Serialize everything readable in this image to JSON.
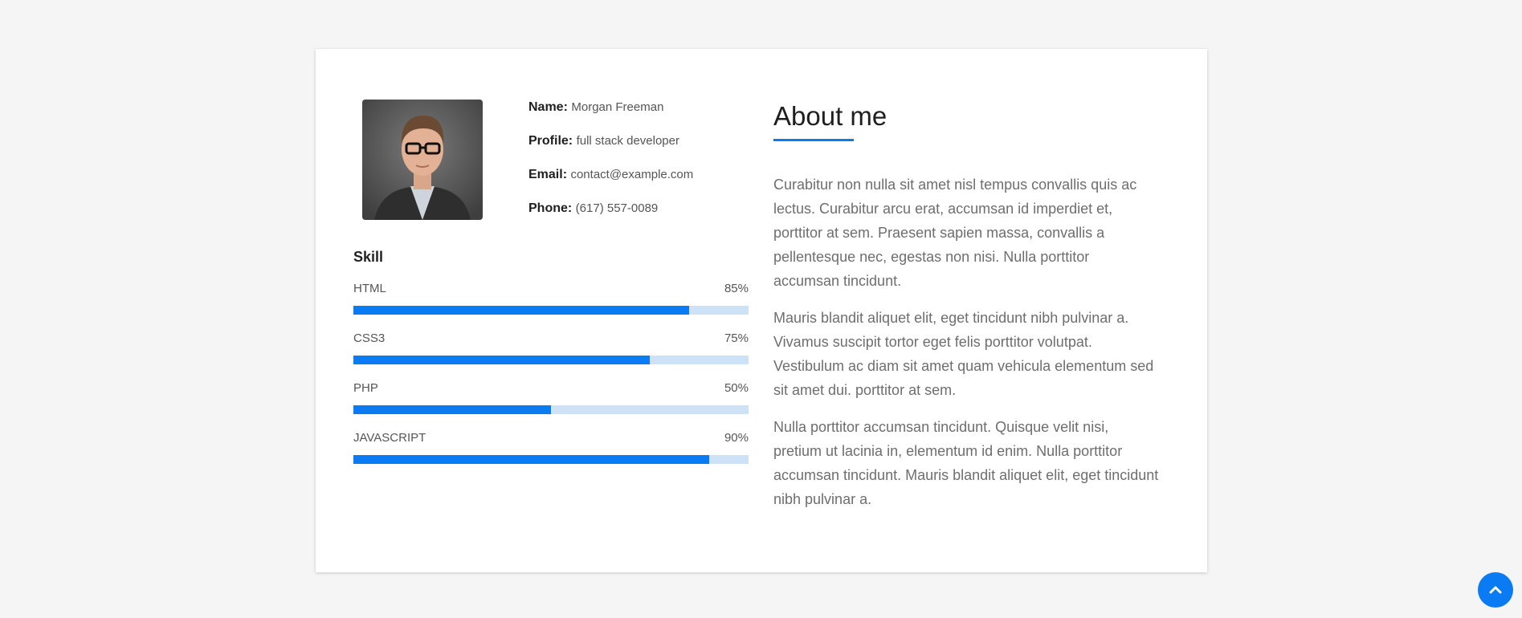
{
  "profile": {
    "name_label": "Name:",
    "name_value": "Morgan Freeman",
    "profile_label": "Profile:",
    "profile_value": "full stack developer",
    "email_label": "Email:",
    "email_value": "contact@example.com",
    "phone_label": "Phone:",
    "phone_value": "(617) 557-0089",
    "photo_icon": "person-photo"
  },
  "skills": {
    "title": "Skill",
    "items": [
      {
        "name": "HTML",
        "percent_label": "85%",
        "value": 85
      },
      {
        "name": "CSS3",
        "percent_label": "75%",
        "value": 75
      },
      {
        "name": "PHP",
        "percent_label": "50%",
        "value": 50
      },
      {
        "name": "JAVASCRIPT",
        "percent_label": "90%",
        "value": 90
      }
    ]
  },
  "about": {
    "title": "About me",
    "paragraphs": [
      "Curabitur non nulla sit amet nisl tempus convallis quis ac lectus. Curabitur arcu erat, accumsan id imperdiet et, porttitor at sem. Praesent sapien massa, convallis a pellentesque nec, egestas non nisi. Nulla porttitor accumsan tincidunt.",
      "Mauris blandit aliquet elit, eget tincidunt nibh pulvinar a. Vivamus suscipit tortor eget felis porttitor volutpat. Vestibulum ac diam sit amet quam vehicula elementum sed sit amet dui. porttitor at sem.",
      "Nulla porttitor accumsan tincidunt. Quisque velit nisi, pretium ut lacinia in, elementum id enim. Nulla porttitor accumsan tincidunt. Mauris blandit aliquet elit, eget tincidunt nibh pulvinar a."
    ]
  },
  "back_to_top": {
    "icon": "chevron-up-icon"
  },
  "colors": {
    "accent": "#0a7bf2",
    "bar_track": "#cde2f7",
    "page_bg": "#f5f5f5"
  }
}
